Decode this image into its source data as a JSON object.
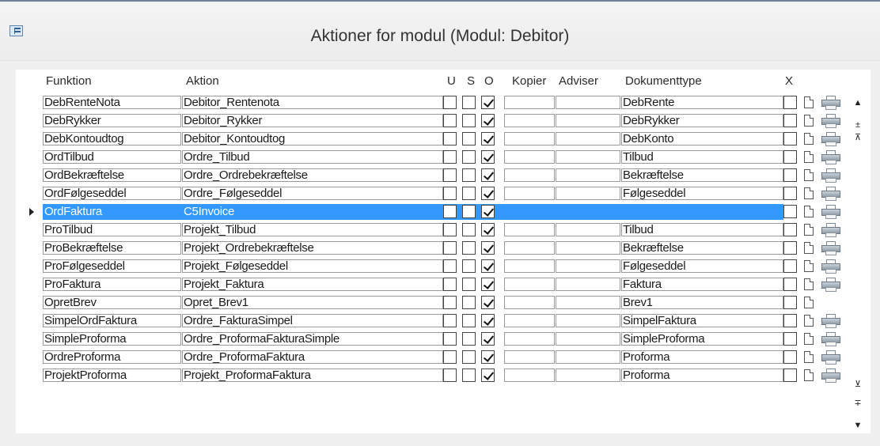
{
  "window": {
    "title": "Aktioner for modul (Modul: Debitor)",
    "icon": "form-icon"
  },
  "headers": {
    "funktion": "Funktion",
    "aktion": "Aktion",
    "u": "U",
    "s": "S",
    "o": "O",
    "kopier": "Kopier",
    "adviser": "Adviser",
    "dokumenttype": "Dokumenttype",
    "x": "X"
  },
  "rows": [
    {
      "funktion": "DebRenteNota",
      "aktion": "Debitor_Rentenota",
      "u": false,
      "s": false,
      "o": true,
      "dokumenttype": "DebRente",
      "printer": true
    },
    {
      "funktion": "DebRykker",
      "aktion": "Debitor_Rykker",
      "u": false,
      "s": false,
      "o": true,
      "dokumenttype": "DebRykker",
      "printer": true
    },
    {
      "funktion": "DebKontoudtog",
      "aktion": "Debitor_Kontoudtog",
      "u": false,
      "s": false,
      "o": true,
      "dokumenttype": "DebKonto",
      "printer": true
    },
    {
      "funktion": "OrdTilbud",
      "aktion": "Ordre_Tilbud",
      "u": false,
      "s": false,
      "o": true,
      "dokumenttype": "Tilbud",
      "printer": true
    },
    {
      "funktion": "OrdBekræftelse",
      "aktion": "Ordre_Ordrebekræftelse",
      "u": false,
      "s": false,
      "o": true,
      "dokumenttype": "Bekræftelse",
      "printer": true
    },
    {
      "funktion": "OrdFølgeseddel",
      "aktion": "Ordre_Følgeseddel",
      "u": false,
      "s": false,
      "o": true,
      "dokumenttype": "Følgeseddel",
      "printer": true
    },
    {
      "funktion": "OrdFaktura",
      "aktion": "C5Invoice",
      "u": false,
      "s": false,
      "o": true,
      "dokumenttype": "",
      "printer": true,
      "selected": true
    },
    {
      "funktion": "ProTilbud",
      "aktion": "Projekt_Tilbud",
      "u": false,
      "s": false,
      "o": true,
      "dokumenttype": "Tilbud",
      "printer": true
    },
    {
      "funktion": "ProBekræftelse",
      "aktion": "Projekt_Ordrebekræftelse",
      "u": false,
      "s": false,
      "o": true,
      "dokumenttype": "Bekræftelse",
      "printer": true
    },
    {
      "funktion": "ProFølgeseddel",
      "aktion": "Projekt_Følgeseddel",
      "u": false,
      "s": false,
      "o": true,
      "dokumenttype": "Følgeseddel",
      "printer": true
    },
    {
      "funktion": "ProFaktura",
      "aktion": "Projekt_Faktura",
      "u": false,
      "s": false,
      "o": true,
      "dokumenttype": "Faktura",
      "printer": true
    },
    {
      "funktion": "OpretBrev",
      "aktion": "Opret_Brev1",
      "u": false,
      "s": false,
      "o": true,
      "dokumenttype": "Brev1",
      "printer": false
    },
    {
      "funktion": "SimpelOrdFaktura",
      "aktion": "Ordre_FakturaSimpel",
      "u": false,
      "s": false,
      "o": true,
      "dokumenttype": "SimpelFaktura",
      "printer": true
    },
    {
      "funktion": "SimpleProforma",
      "aktion": "Ordre_ProformaFakturaSimple",
      "u": false,
      "s": false,
      "o": true,
      "dokumenttype": "SimpleProforma",
      "printer": true
    },
    {
      "funktion": "OrdreProforma",
      "aktion": "Ordre_ProformaFaktura",
      "u": false,
      "s": false,
      "o": true,
      "dokumenttype": "Proforma",
      "printer": true
    },
    {
      "funktion": "ProjektProforma",
      "aktion": "Projekt_ProformaFaktura",
      "u": false,
      "s": false,
      "o": true,
      "dokumenttype": "Proforma",
      "printer": true
    }
  ],
  "navigation": {
    "scroll_up": "▲",
    "record_up": "±",
    "record_first": "⊼",
    "record_last": "⊻",
    "record_down": "∓",
    "scroll_down": "▼"
  }
}
